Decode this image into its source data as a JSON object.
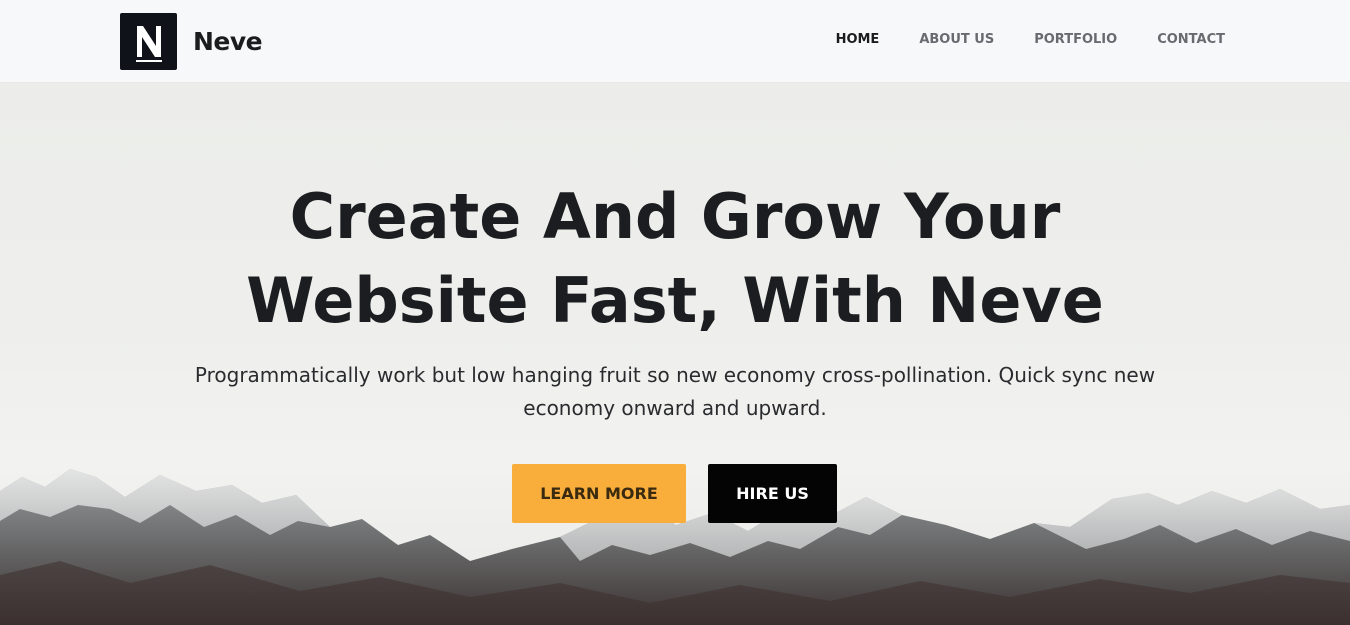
{
  "site": {
    "logo_letter": "N",
    "name": "Neve"
  },
  "nav": {
    "items": [
      {
        "label": "HOME",
        "active": true
      },
      {
        "label": "ABOUT US",
        "active": false
      },
      {
        "label": "PORTFOLIO",
        "active": false
      },
      {
        "label": "CONTACT",
        "active": false
      }
    ]
  },
  "hero": {
    "title_line1": "Create And Grow Your",
    "title_line2": "Website Fast, With Neve",
    "subtitle": "Programmatically work but low hanging fruit so new economy cross-pollination. Quick sync new economy onward and upward.",
    "primary_button": "LEARN MORE",
    "secondary_button": "HIRE US"
  },
  "colors": {
    "accent": "#f9ae3b",
    "dark": "#040405",
    "header_bg": "#f7f8f9",
    "hero_bg": "#ecedea"
  },
  "icons": {
    "logo": "neve-logo-icon"
  }
}
